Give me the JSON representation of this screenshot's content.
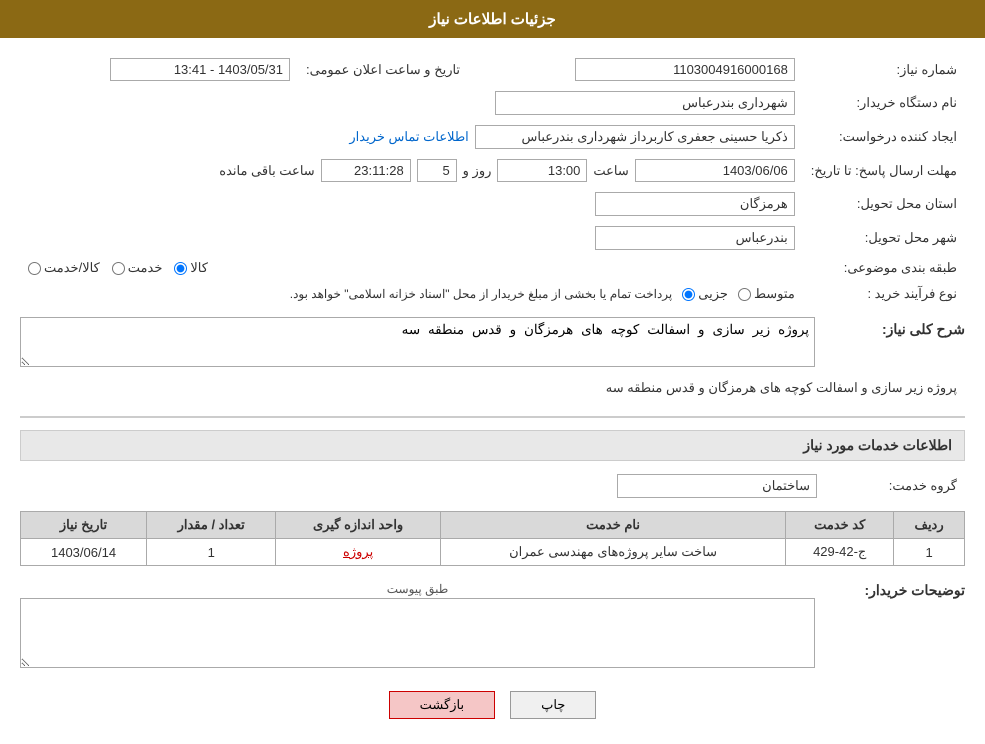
{
  "header": {
    "title": "جزئیات اطلاعات نیاز"
  },
  "fields": {
    "need_number_label": "شماره نیاز:",
    "need_number_value": "1103004916000168",
    "buyer_org_label": "نام دستگاه خریدار:",
    "buyer_org_value": "شهرداری بندرعباس",
    "public_announce_label": "تاریخ و ساعت اعلان عمومی:",
    "public_announce_value": "1403/05/31 - 13:41",
    "creator_label": "ایجاد کننده درخواست:",
    "creator_value": "ذکریا حسینی جعفری کاربرداز شهرداری بندرعباس",
    "contact_link": "اطلاعات تماس خریدار",
    "response_deadline_label": "مهلت ارسال پاسخ: تا تاریخ:",
    "response_date": "1403/06/06",
    "response_time_label": "ساعت",
    "response_time": "13:00",
    "response_days_label": "روز و",
    "response_days": "5",
    "response_remaining_label": "ساعت باقی مانده",
    "response_remaining": "23:11:28",
    "province_label": "استان محل تحویل:",
    "province_value": "هرمزگان",
    "city_label": "شهر محل تحویل:",
    "city_value": "بندرعباس",
    "category_label": "طبقه بندی موضوعی:",
    "category_options": [
      "کالا",
      "خدمت",
      "کالا/خدمت"
    ],
    "category_selected": "کالا",
    "purchase_type_label": "نوع فرآیند خرید :",
    "purchase_type_options": [
      "جزیی",
      "متوسط"
    ],
    "purchase_type_note": "پرداخت تمام یا بخشی از مبلغ خریدار از محل \"اسناد خزانه اسلامی\" خواهد بود.",
    "need_description_label": "شرح کلی نیاز:",
    "need_description_value": "پروژه زیر سازی و اسفالت کوچه های هرمزگان و قدس منطقه سه",
    "services_section_title": "اطلاعات خدمات مورد نیاز",
    "service_group_label": "گروه خدمت:",
    "service_group_value": "ساختمان",
    "table": {
      "headers": [
        "ردیف",
        "کد خدمت",
        "نام خدمت",
        "واحد اندازه گیری",
        "تعداد / مقدار",
        "تاریخ نیاز"
      ],
      "rows": [
        {
          "row_num": "1",
          "service_code": "ج-42-429",
          "service_name": "ساخت سایر پروژه‌های مهندسی عمران",
          "unit": "پروژه",
          "quantity": "1",
          "need_date": "1403/06/14"
        }
      ]
    },
    "buyer_notes_label": "توضیحات خریدار:",
    "buyer_notes_placeholder": "طبق پیوست"
  },
  "buttons": {
    "back_label": "بازگشت",
    "print_label": "چاپ"
  }
}
